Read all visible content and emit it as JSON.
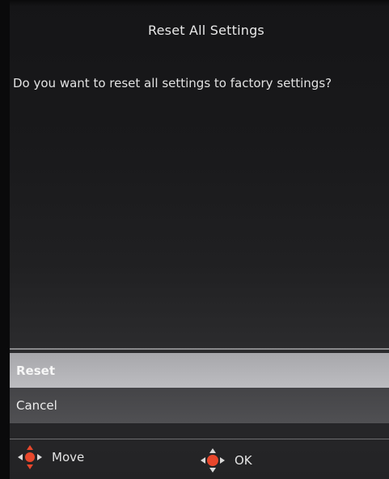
{
  "dialog": {
    "title": "Reset All Settings",
    "question": "Do you want to reset all settings to factory settings?"
  },
  "options": [
    {
      "label": "Reset",
      "selected": true
    },
    {
      "label": "Cancel",
      "selected": false
    }
  ],
  "hints": {
    "move": {
      "label": "Move",
      "icon": "dpad-left-right-icon"
    },
    "ok": {
      "label": "OK",
      "icon": "dpad-center-icon"
    }
  },
  "colors": {
    "accent": "#e8472c",
    "selected_bg": "#b3b3b7",
    "unselected_bg": "#4a4a4d"
  }
}
